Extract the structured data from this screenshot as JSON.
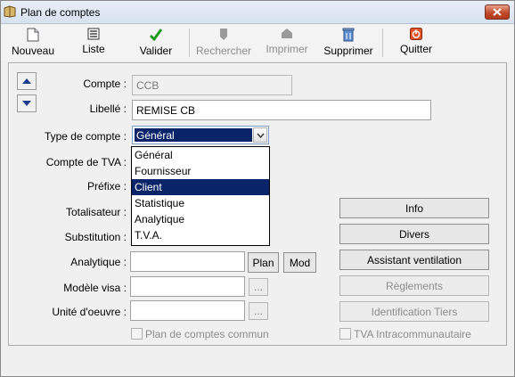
{
  "window": {
    "title": "Plan de comptes"
  },
  "toolbar": {
    "items": [
      {
        "label": "Nouveau",
        "icon": "new-document-icon",
        "enabled": true
      },
      {
        "label": "Liste",
        "icon": "list-icon",
        "enabled": true
      },
      {
        "label": "Valider",
        "icon": "checkmark-icon",
        "enabled": true
      },
      {
        "label": "Rechercher",
        "icon": "search-icon",
        "enabled": false
      },
      {
        "label": "Imprimer",
        "icon": "printer-icon",
        "enabled": false
      },
      {
        "label": "Supprimer",
        "icon": "recycle-bin-icon",
        "enabled": true
      },
      {
        "label": "Quitter",
        "icon": "power-icon",
        "enabled": true
      }
    ]
  },
  "form": {
    "compte": {
      "label": "Compte :",
      "value": "CCB"
    },
    "libelle": {
      "label": "Libellé :",
      "value": "REMISE CB"
    },
    "type_compte": {
      "label": "Type de compte :",
      "value": "Général"
    },
    "compte_tva": {
      "label": "Compte de TVA :"
    },
    "prefixe": {
      "label": "Préfixe :"
    },
    "totalisateur": {
      "label": "Totalisateur :"
    },
    "substitution": {
      "label": "Substitution :"
    },
    "analytique": {
      "label": "Analytique :",
      "value": ""
    },
    "modele_visa": {
      "label": "Modèle visa :",
      "value": ""
    },
    "unite_oeuvre": {
      "label": "Unité d'oeuvre :",
      "value": ""
    },
    "plan_button": "Plan",
    "mod_button": "Mod",
    "browse_button": "...",
    "plan_commun": "Plan de comptes commun",
    "tva_intra": "TVA Intracommunautaire"
  },
  "dropdown": {
    "options": [
      "Général",
      "Fournisseur",
      "Client",
      "Statistique",
      "Analytique",
      "T.V.A."
    ],
    "highlighted": "Client"
  },
  "side_buttons": {
    "info": "Info",
    "divers": "Divers",
    "assistant": "Assistant ventilation",
    "reglements": "Règlements",
    "identification": "Identification Tiers"
  },
  "colors": {
    "selection": "#0a246a",
    "close_button": "#c24a2a",
    "nav_arrow": "#1a3e8c"
  }
}
